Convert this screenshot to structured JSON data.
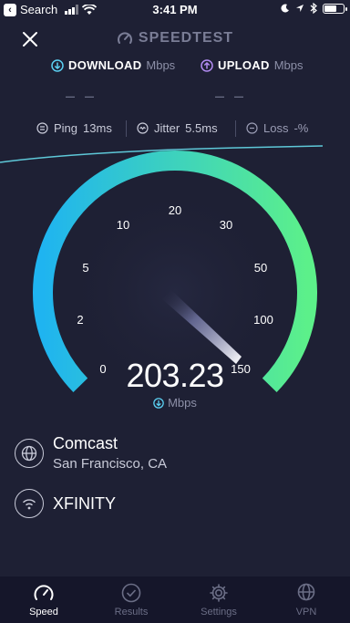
{
  "status_bar": {
    "back_label": "Search",
    "time": "3:41 PM"
  },
  "header": {
    "brand": "SPEEDTEST"
  },
  "download": {
    "label": "DOWNLOAD",
    "unit": "Mbps",
    "value": "– –"
  },
  "upload": {
    "label": "UPLOAD",
    "unit": "Mbps",
    "value": "– –"
  },
  "stats": {
    "ping_label": "Ping",
    "ping_value": "13ms",
    "jitter_label": "Jitter",
    "jitter_value": "5.5ms",
    "loss_label": "Loss",
    "loss_value": "-%"
  },
  "gauge": {
    "value": "203.23",
    "unit": "Mbps",
    "ticks": [
      "0",
      "2",
      "5",
      "10",
      "20",
      "30",
      "50",
      "100",
      "150"
    ]
  },
  "provider": {
    "isp_name": "Comcast",
    "isp_location": "San Francisco, CA",
    "wifi_name": "XFINITY"
  },
  "tabs": [
    {
      "label": "Speed"
    },
    {
      "label": "Results"
    },
    {
      "label": "Settings"
    },
    {
      "label": "VPN"
    }
  ],
  "colors": {
    "background": "#1e2034",
    "gauge_start": "#1fb4f0",
    "gauge_end": "#5cf08a",
    "download_accent": "#5bd0f2",
    "upload_accent": "#b28cf2"
  }
}
